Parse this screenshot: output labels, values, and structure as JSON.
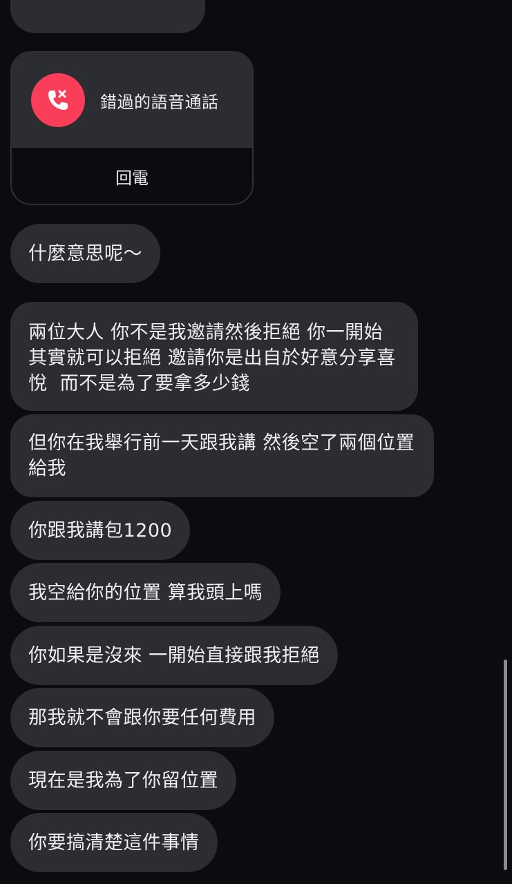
{
  "missed_call": {
    "title": "錯過的語音通話",
    "call_back_label": "回電"
  },
  "messages": [
    "什麼意思呢～",
    "兩位大人 你不是我邀請然後拒絕 你一開始其實就可以拒絕 邀請你是出自於好意分享喜悅  而不是為了要拿多少錢",
    "但你在我舉行前一天跟我講 然後空了兩個位置給我",
    "你跟我講包1200",
    "我空給你的位置 算我頭上嗎",
    "你如果是沒來 一開始直接跟我拒絕",
    "那我就不會跟你要任何費用",
    "現在是我為了你留位置",
    "你要搞清楚這件事情"
  ],
  "colors": {
    "background": "#0b0c0f",
    "bubble": "#2b2d31",
    "missed_call_icon": "#fa3e5a",
    "text": "#eceff3"
  },
  "icons": {
    "missed_call": "phone-missed-icon"
  }
}
